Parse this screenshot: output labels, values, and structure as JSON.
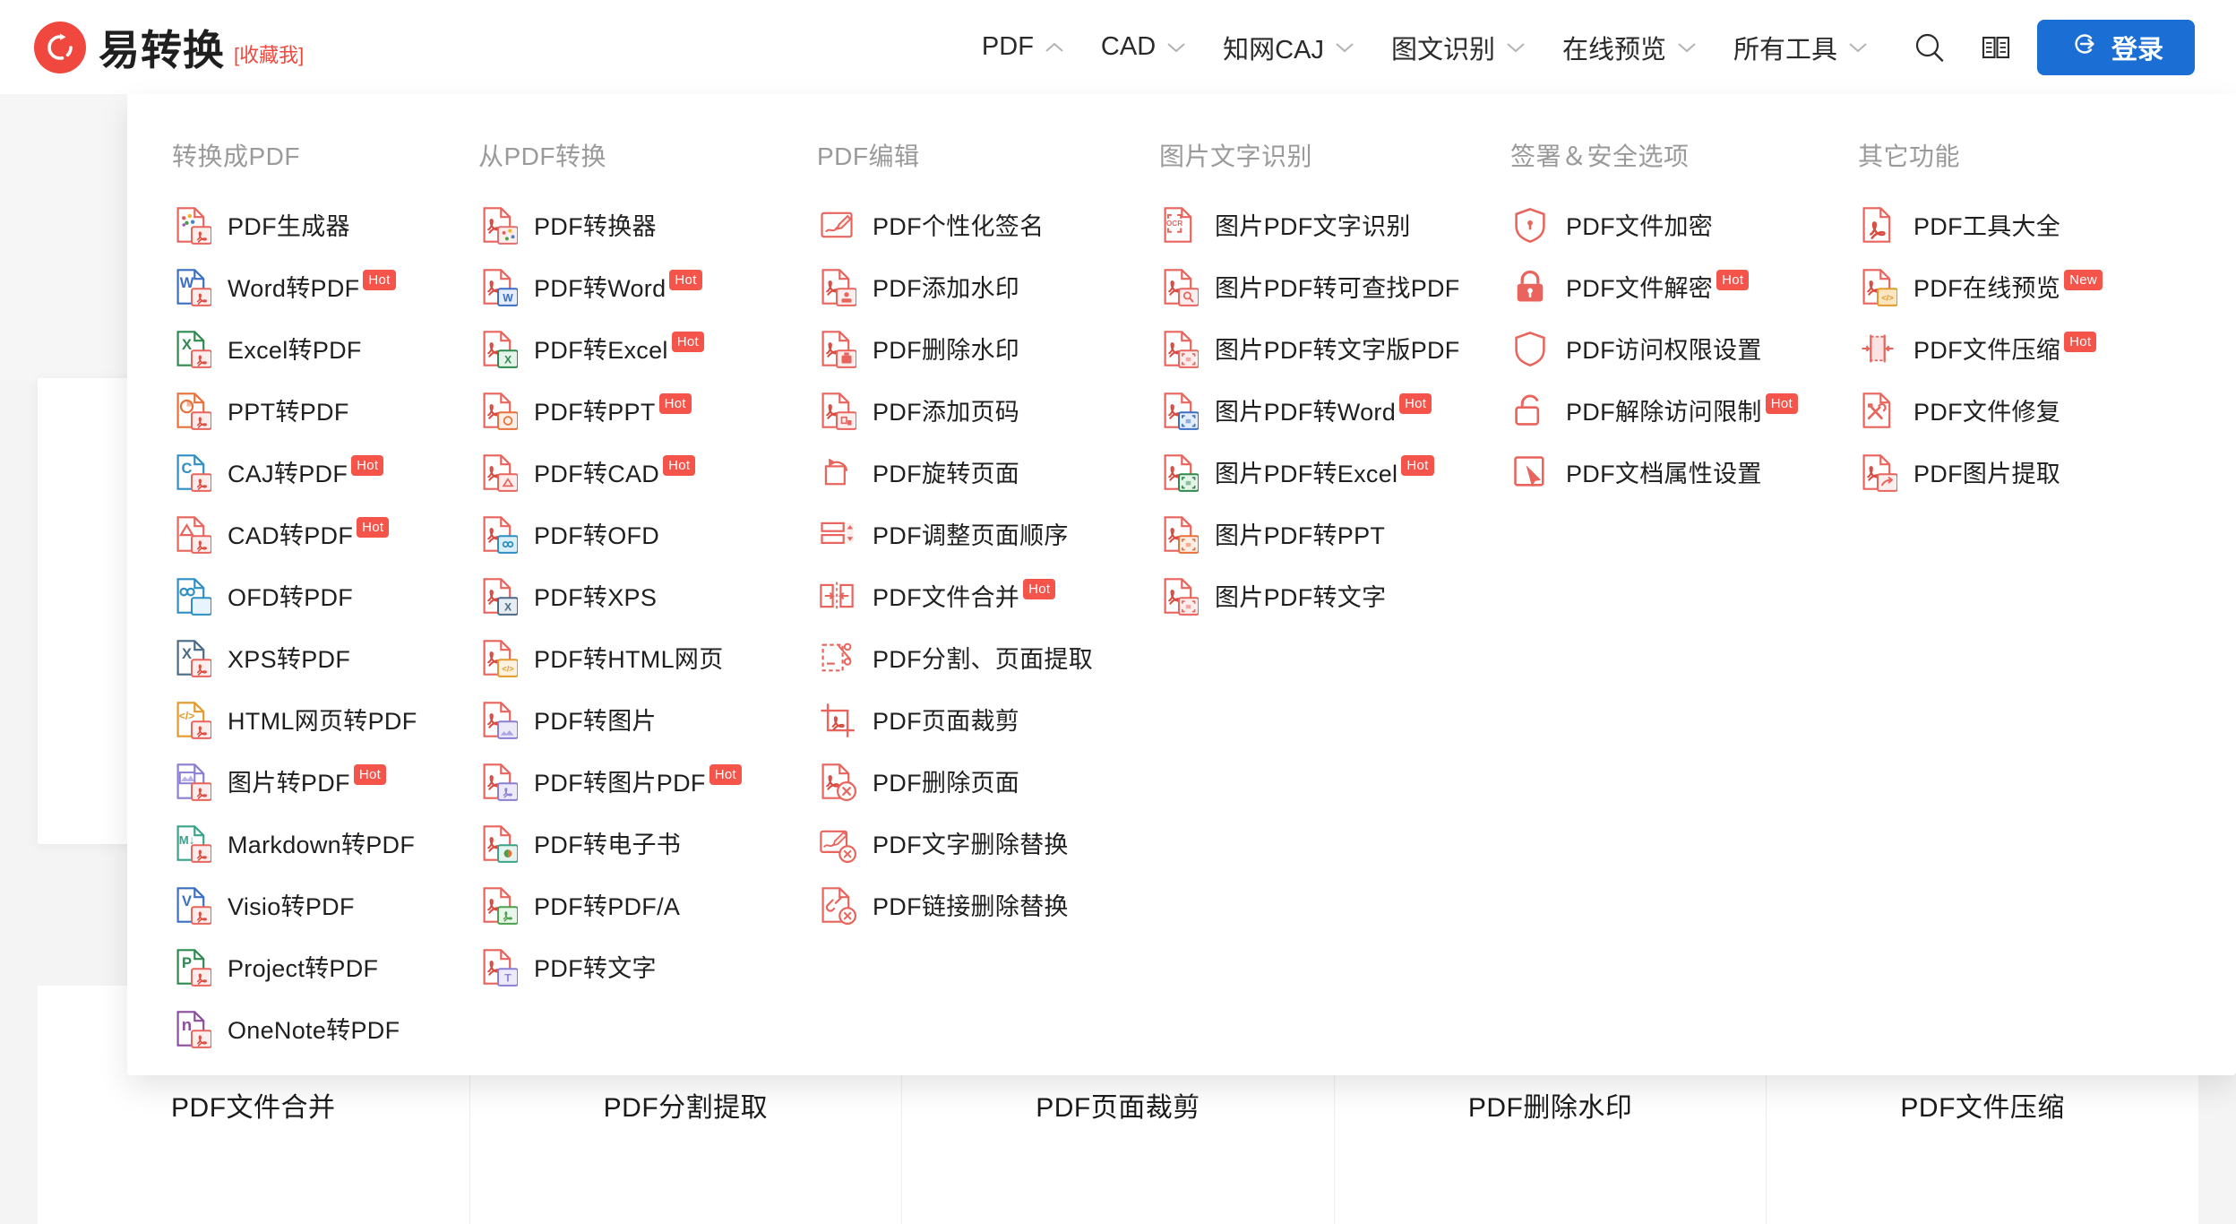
{
  "header": {
    "brand_name": "易转换",
    "favorite_label": "[收藏我]",
    "logo_icon": "refresh-circle-icon",
    "nav": [
      {
        "label": "PDF",
        "caret": "chevron-up-icon",
        "expanded": true
      },
      {
        "label": "CAD",
        "caret": "chevron-down-icon",
        "expanded": false
      },
      {
        "label": "知网CAJ",
        "caret": "chevron-down-icon",
        "expanded": false
      },
      {
        "label": "图文识别",
        "caret": "chevron-down-icon",
        "expanded": false
      },
      {
        "label": "在线预览",
        "caret": "chevron-down-icon",
        "expanded": false
      },
      {
        "label": "所有工具",
        "caret": "chevron-down-icon",
        "expanded": false
      }
    ],
    "search_icon": "search-icon",
    "manual_icon": "book-icon",
    "login_label": "登录",
    "login_icon": "login-arrow-icon",
    "login_bg": "#1b6fd4"
  },
  "accent": {
    "red": "#f0483e",
    "badge": "#f4544a",
    "blue": "#1b6fd4"
  },
  "mega_menu": {
    "open_for": "PDF",
    "columns": [
      {
        "title": "转换成PDF",
        "items": [
          {
            "label": "PDF生成器",
            "badge": "",
            "icon": "pdf-generator-icon"
          },
          {
            "label": "Word转PDF",
            "badge": "Hot",
            "icon": "word-to-pdf-icon"
          },
          {
            "label": "Excel转PDF",
            "badge": "",
            "icon": "excel-to-pdf-icon"
          },
          {
            "label": "PPT转PDF",
            "badge": "",
            "icon": "ppt-to-pdf-icon"
          },
          {
            "label": "CAJ转PDF",
            "badge": "Hot",
            "icon": "caj-to-pdf-icon"
          },
          {
            "label": "CAD转PDF",
            "badge": "Hot",
            "icon": "cad-to-pdf-icon"
          },
          {
            "label": "OFD转PDF",
            "badge": "",
            "icon": "ofd-to-pdf-icon"
          },
          {
            "label": "XPS转PDF",
            "badge": "",
            "icon": "xps-to-pdf-icon"
          },
          {
            "label": "HTML网页转PDF",
            "badge": "",
            "icon": "html-to-pdf-icon"
          },
          {
            "label": "图片转PDF",
            "badge": "Hot",
            "icon": "image-to-pdf-icon"
          },
          {
            "label": "Markdown转PDF",
            "badge": "",
            "icon": "markdown-to-pdf-icon"
          },
          {
            "label": "Visio转PDF",
            "badge": "",
            "icon": "visio-to-pdf-icon"
          },
          {
            "label": "Project转PDF",
            "badge": "",
            "icon": "project-to-pdf-icon"
          },
          {
            "label": "OneNote转PDF",
            "badge": "",
            "icon": "onenote-to-pdf-icon"
          }
        ]
      },
      {
        "title": "从PDF转换",
        "items": [
          {
            "label": "PDF转换器",
            "badge": "",
            "icon": "pdf-converter-icon"
          },
          {
            "label": "PDF转Word",
            "badge": "Hot",
            "icon": "pdf-to-word-icon"
          },
          {
            "label": "PDF转Excel",
            "badge": "Hot",
            "icon": "pdf-to-excel-icon"
          },
          {
            "label": "PDF转PPT",
            "badge": "Hot",
            "icon": "pdf-to-ppt-icon"
          },
          {
            "label": "PDF转CAD",
            "badge": "Hot",
            "icon": "pdf-to-cad-icon"
          },
          {
            "label": "PDF转OFD",
            "badge": "",
            "icon": "pdf-to-ofd-icon"
          },
          {
            "label": "PDF转XPS",
            "badge": "",
            "icon": "pdf-to-xps-icon"
          },
          {
            "label": "PDF转HTML网页",
            "badge": "",
            "icon": "pdf-to-html-icon"
          },
          {
            "label": "PDF转图片",
            "badge": "",
            "icon": "pdf-to-image-icon"
          },
          {
            "label": "PDF转图片PDF",
            "badge": "Hot",
            "icon": "pdf-to-image-pdf-icon"
          },
          {
            "label": "PDF转电子书",
            "badge": "",
            "icon": "pdf-to-ebook-icon"
          },
          {
            "label": "PDF转PDF/A",
            "badge": "",
            "icon": "pdf-to-pdfa-icon"
          },
          {
            "label": "PDF转文字",
            "badge": "",
            "icon": "pdf-to-text-icon"
          }
        ]
      },
      {
        "title": "PDF编辑",
        "items": [
          {
            "label": "PDF个性化签名",
            "badge": "",
            "icon": "pdf-signature-icon"
          },
          {
            "label": "PDF添加水印",
            "badge": "",
            "icon": "pdf-add-watermark-icon"
          },
          {
            "label": "PDF删除水印",
            "badge": "",
            "icon": "pdf-remove-watermark-icon"
          },
          {
            "label": "PDF添加页码",
            "badge": "",
            "icon": "pdf-add-page-number-icon"
          },
          {
            "label": "PDF旋转页面",
            "badge": "",
            "icon": "pdf-rotate-page-icon"
          },
          {
            "label": "PDF调整页面顺序",
            "badge": "",
            "icon": "pdf-reorder-pages-icon"
          },
          {
            "label": "PDF文件合并",
            "badge": "Hot",
            "icon": "pdf-merge-icon"
          },
          {
            "label": "PDF分割、页面提取",
            "badge": "",
            "icon": "pdf-split-icon"
          },
          {
            "label": "PDF页面裁剪",
            "badge": "",
            "icon": "pdf-crop-icon"
          },
          {
            "label": "PDF删除页面",
            "badge": "",
            "icon": "pdf-delete-page-icon"
          },
          {
            "label": "PDF文字删除替换",
            "badge": "",
            "icon": "pdf-replace-text-icon"
          },
          {
            "label": "PDF链接删除替换",
            "badge": "",
            "icon": "pdf-replace-link-icon"
          }
        ]
      },
      {
        "title": "图片文字识别",
        "items": [
          {
            "label": "图片PDF文字识别",
            "badge": "",
            "icon": "ocr-icon"
          },
          {
            "label": "图片PDF转可查找PDF",
            "badge": "",
            "icon": "ocr-searchable-pdf-icon"
          },
          {
            "label": "图片PDF转文字版PDF",
            "badge": "",
            "icon": "ocr-text-pdf-icon"
          },
          {
            "label": "图片PDF转Word",
            "badge": "Hot",
            "icon": "ocr-to-word-icon"
          },
          {
            "label": "图片PDF转Excel",
            "badge": "Hot",
            "icon": "ocr-to-excel-icon"
          },
          {
            "label": "图片PDF转PPT",
            "badge": "",
            "icon": "ocr-to-ppt-icon"
          },
          {
            "label": "图片PDF转文字",
            "badge": "",
            "icon": "ocr-to-text-icon"
          }
        ]
      },
      {
        "title": "签署＆安全选项",
        "items": [
          {
            "label": "PDF文件加密",
            "badge": "",
            "icon": "shield-lock-icon"
          },
          {
            "label": "PDF文件解密",
            "badge": "Hot",
            "icon": "lock-icon"
          },
          {
            "label": "PDF访问权限设置",
            "badge": "",
            "icon": "shield-icon"
          },
          {
            "label": "PDF解除访问限制",
            "badge": "Hot",
            "icon": "unlock-icon"
          },
          {
            "label": "PDF文档属性设置",
            "badge": "",
            "icon": "cursor-box-icon"
          }
        ]
      },
      {
        "title": "其它功能",
        "items": [
          {
            "label": "PDF工具大全",
            "badge": "",
            "icon": "pdf-toolkit-icon"
          },
          {
            "label": "PDF在线预览",
            "badge": "New",
            "icon": "pdf-preview-icon"
          },
          {
            "label": "PDF文件压缩",
            "badge": "Hot",
            "icon": "pdf-compress-icon"
          },
          {
            "label": "PDF文件修复",
            "badge": "",
            "icon": "pdf-repair-icon"
          },
          {
            "label": "PDF图片提取",
            "badge": "",
            "icon": "pdf-extract-image-icon"
          }
        ]
      }
    ]
  },
  "background_tiles": [
    {
      "label": "PDF文件合并",
      "marked": false
    },
    {
      "label": "PDF分割提取",
      "marked": false
    },
    {
      "label": "PDF页面裁剪",
      "marked": true
    },
    {
      "label": "PDF删除水印",
      "marked": true
    },
    {
      "label": "PDF文件压缩",
      "marked": false
    }
  ]
}
